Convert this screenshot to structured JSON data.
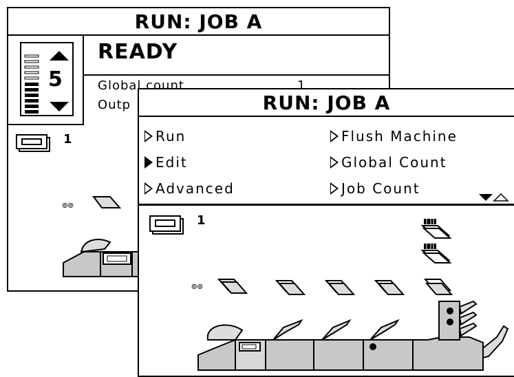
{
  "back_window": {
    "title": "RUN: JOB A",
    "status": "READY",
    "counter_value": "5",
    "rows": [
      {
        "label": "Global count",
        "value": "1"
      },
      {
        "label": "Outp",
        "value": ""
      }
    ],
    "stack_label": "1"
  },
  "front_window": {
    "title": "RUN: JOB A",
    "menu": [
      {
        "label": "Run",
        "selected": false
      },
      {
        "label": "Flush Machine",
        "selected": false
      },
      {
        "label": "Edit",
        "selected": true
      },
      {
        "label": "Global Count",
        "selected": false
      },
      {
        "label": "Advanced",
        "selected": false
      },
      {
        "label": "Job Count",
        "selected": false
      }
    ],
    "stack_label": "1",
    "scroll_icons": [
      "scroll-down-icon",
      "scroll-up-icon"
    ]
  }
}
